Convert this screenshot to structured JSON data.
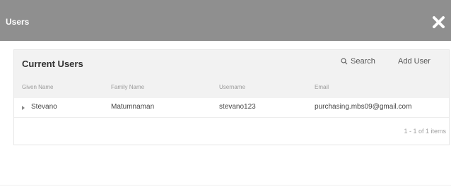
{
  "modal": {
    "title": "Users",
    "header_color": "#8f8f8f"
  },
  "panel": {
    "title": "Current Users",
    "search_label": "Search",
    "add_user_label": "Add User"
  },
  "table": {
    "columns": [
      "Given Name",
      "Family Name",
      "Username",
      "Email"
    ],
    "rows": [
      {
        "given_name": "Stevano",
        "family_name": "Matumnaman",
        "username": "stevano123",
        "email": "purchasing.mbs09@gmail.com"
      }
    ]
  },
  "pager": {
    "text": "1 - 1 of 1 items"
  },
  "icons": {
    "close": "close-icon",
    "search": "search-icon",
    "expand": "expand-arrow-icon"
  }
}
